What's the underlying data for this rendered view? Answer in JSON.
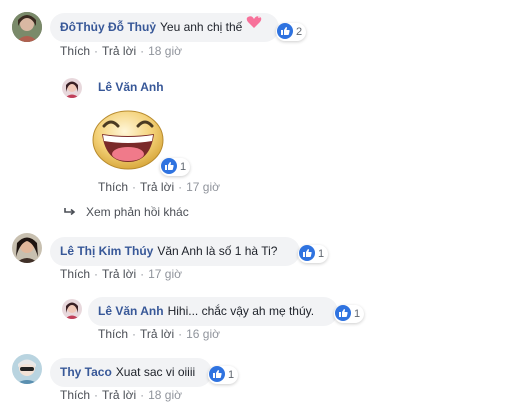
{
  "comments": [
    {
      "name": "ĐôThủy Đỗ Thuỷ",
      "text": "Yeu anh chị thế",
      "reactions": "2",
      "like": "Thích",
      "reply": "Trả lời",
      "time": "18 giờ"
    },
    {
      "name": "Lê Văn Anh",
      "reactions": "1",
      "like": "Thích",
      "reply": "Trả lời",
      "time": "17 giờ"
    },
    {
      "name": "Lê Thị Kim Thúy",
      "text": "Văn Anh là số 1 hà Ti?",
      "reactions": "1",
      "like": "Thích",
      "reply": "Trả lời",
      "time": "17 giờ"
    },
    {
      "name": "Lê Văn Anh",
      "text": "Hihi... chắc vậy ah mẹ thúy.",
      "reactions": "1",
      "like": "Thích",
      "reply": "Trả lời",
      "time": "16 giờ"
    },
    {
      "name": "Thy Taco",
      "text": "Xuat sac vi oiiii",
      "reactions": "1",
      "like": "Thích",
      "reply": "Trả lời",
      "time": "18 giờ"
    }
  ],
  "more_replies": "Xem phản hồi khác",
  "colors": {
    "name": "#385898",
    "bubble": "#f2f3f5",
    "like": "#2f73e0"
  }
}
